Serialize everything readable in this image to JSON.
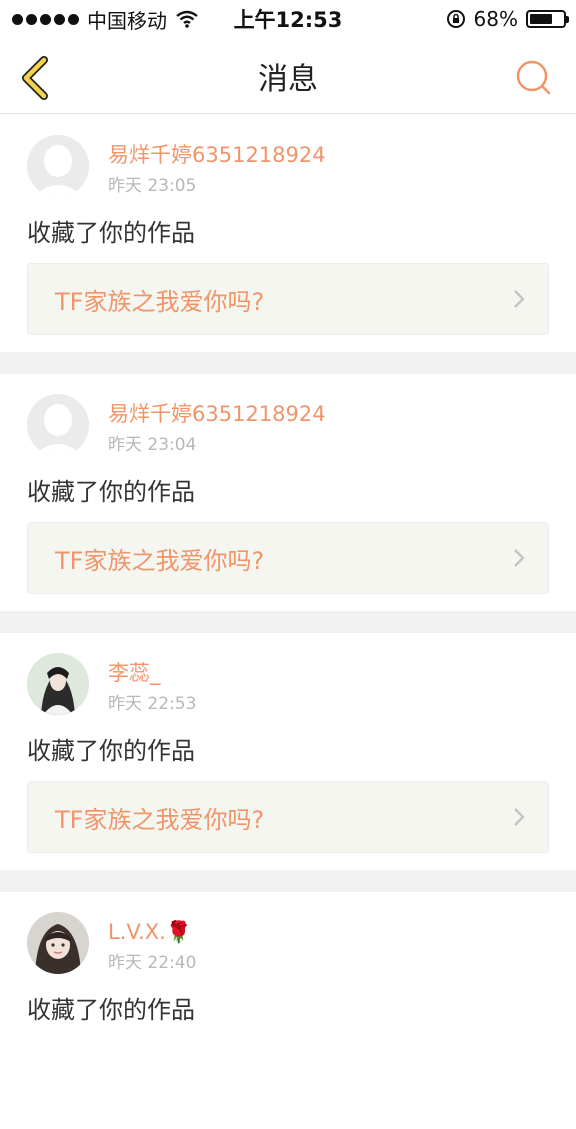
{
  "status_bar": {
    "carrier": "中国移动",
    "time": "上午12:53",
    "battery": "68%",
    "battery_level": 0.68
  },
  "nav": {
    "title": "消息",
    "back_icon": "chevron-left-icon",
    "search_icon": "search-icon"
  },
  "colors": {
    "accent": "#f0956a",
    "back_arrow": "#f5d44a",
    "card_link_bg": "#f6f6f1"
  },
  "messages": [
    {
      "username": "易烊千婷6351218924",
      "time": "昨天 23:05",
      "action": "收藏了你的作品",
      "work_title": "TF家族之我爱你吗?",
      "avatar": "default"
    },
    {
      "username": "易烊千婷6351218924",
      "time": "昨天 23:04",
      "action": "收藏了你的作品",
      "work_title": "TF家族之我爱你吗?",
      "avatar": "default"
    },
    {
      "username": "李蕊_",
      "time": "昨天 22:53",
      "action": "收藏了你的作品",
      "work_title": "TF家族之我爱你吗?",
      "avatar": "photo"
    },
    {
      "username": "L.V.X.🌹",
      "time": "昨天 22:40",
      "action": "收藏了你的作品",
      "work_title": "",
      "avatar": "photo"
    }
  ]
}
